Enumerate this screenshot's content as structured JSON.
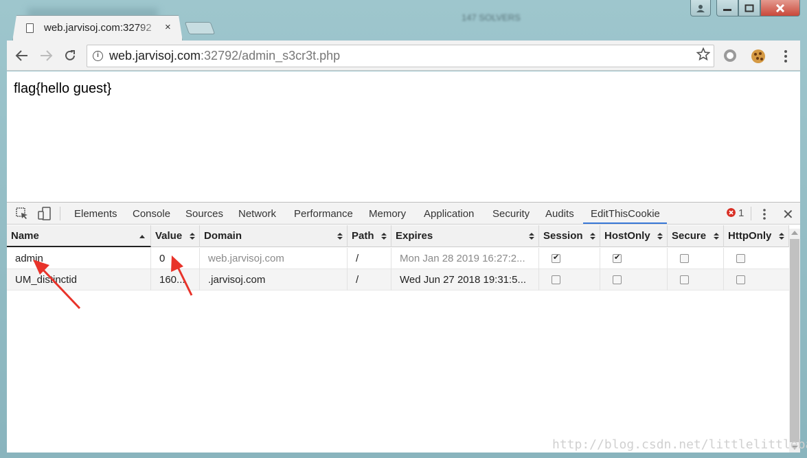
{
  "window": {
    "blurred_title": "147 SOLVERS",
    "close_glyph": "✕",
    "min_glyph": "—",
    "max_glyph": "□"
  },
  "tab": {
    "title": "web.jarvisoj.com:32792",
    "close": "×"
  },
  "omnibox": {
    "host": "web.jarvisoj.com",
    "rest": ":32792/admin_s3cr3t.php",
    "info": "i"
  },
  "page": {
    "flag_text": "flag{hello guest}"
  },
  "devtools": {
    "tabs": [
      "Elements",
      "Console",
      "Sources",
      "Network",
      "Performance",
      "Memory",
      "Application",
      "Security",
      "Audits",
      "EditThisCookie"
    ],
    "active_tab": "EditThisCookie",
    "error_count": "1",
    "close": "✕"
  },
  "cookies": {
    "columns": [
      "Name",
      "Value",
      "Domain",
      "Path",
      "Expires",
      "Session",
      "HostOnly",
      "Secure",
      "HttpOnly"
    ],
    "rows": [
      {
        "name": "admin",
        "value": "0",
        "domain": "web.jarvisoj.com",
        "path": "/",
        "expires": "Mon Jan 28 2019 16:27:2...",
        "session": true,
        "hostonly": true,
        "secure": false,
        "httponly": false
      },
      {
        "name": "UM_distinctid",
        "value": "160...",
        "domain": ".jarvisoj.com",
        "path": "/",
        "expires": "Wed Jun 27 2018 19:31:5...",
        "session": false,
        "hostonly": false,
        "secure": false,
        "httponly": false
      }
    ]
  },
  "watermark": "http://blog.csdn.net/littlelittlebai",
  "colors": {
    "accent": "#3879d9",
    "annotation": "#e8332a",
    "error": "#d93025"
  }
}
